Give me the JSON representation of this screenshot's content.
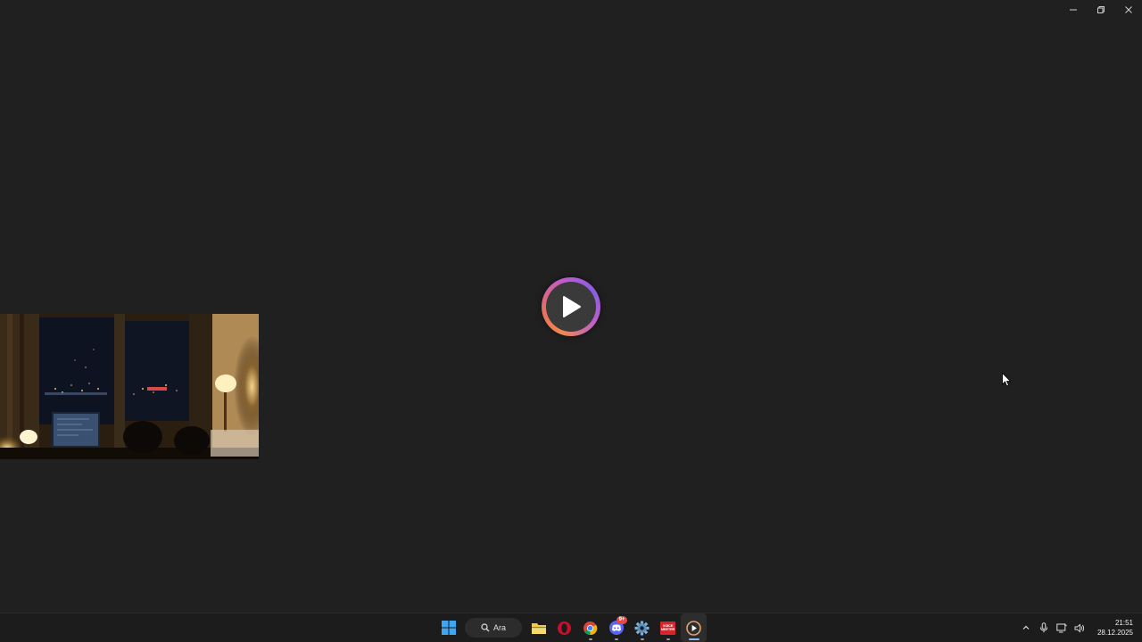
{
  "window": {
    "minimize_icon": "minimize-icon",
    "maximize_icon": "restore-icon",
    "close_icon": "close-icon"
  },
  "player": {
    "play_icon": "play-icon",
    "accent_colors": [
      "#f08a4b",
      "#c05ad0",
      "#8a5de0"
    ]
  },
  "taskbar": {
    "search_placeholder": "Ara",
    "apps": [
      {
        "name": "windows-start",
        "icon": "windows-logo-icon"
      },
      {
        "name": "file-explorer",
        "icon": "folder-icon"
      },
      {
        "name": "opera",
        "icon": "opera-icon"
      },
      {
        "name": "chrome",
        "icon": "chrome-icon"
      },
      {
        "name": "discord",
        "icon": "discord-icon",
        "badge": "9+"
      },
      {
        "name": "settings-app",
        "icon": "gear-icon"
      },
      {
        "name": "voicemeeter",
        "icon": "voicemeeter-icon",
        "label_top": "VOICE",
        "label_bottom": "MEETER"
      },
      {
        "name": "media-player",
        "icon": "play-circle-icon"
      }
    ],
    "clock": {
      "time": "21:51",
      "date": "28.12.2025"
    }
  }
}
